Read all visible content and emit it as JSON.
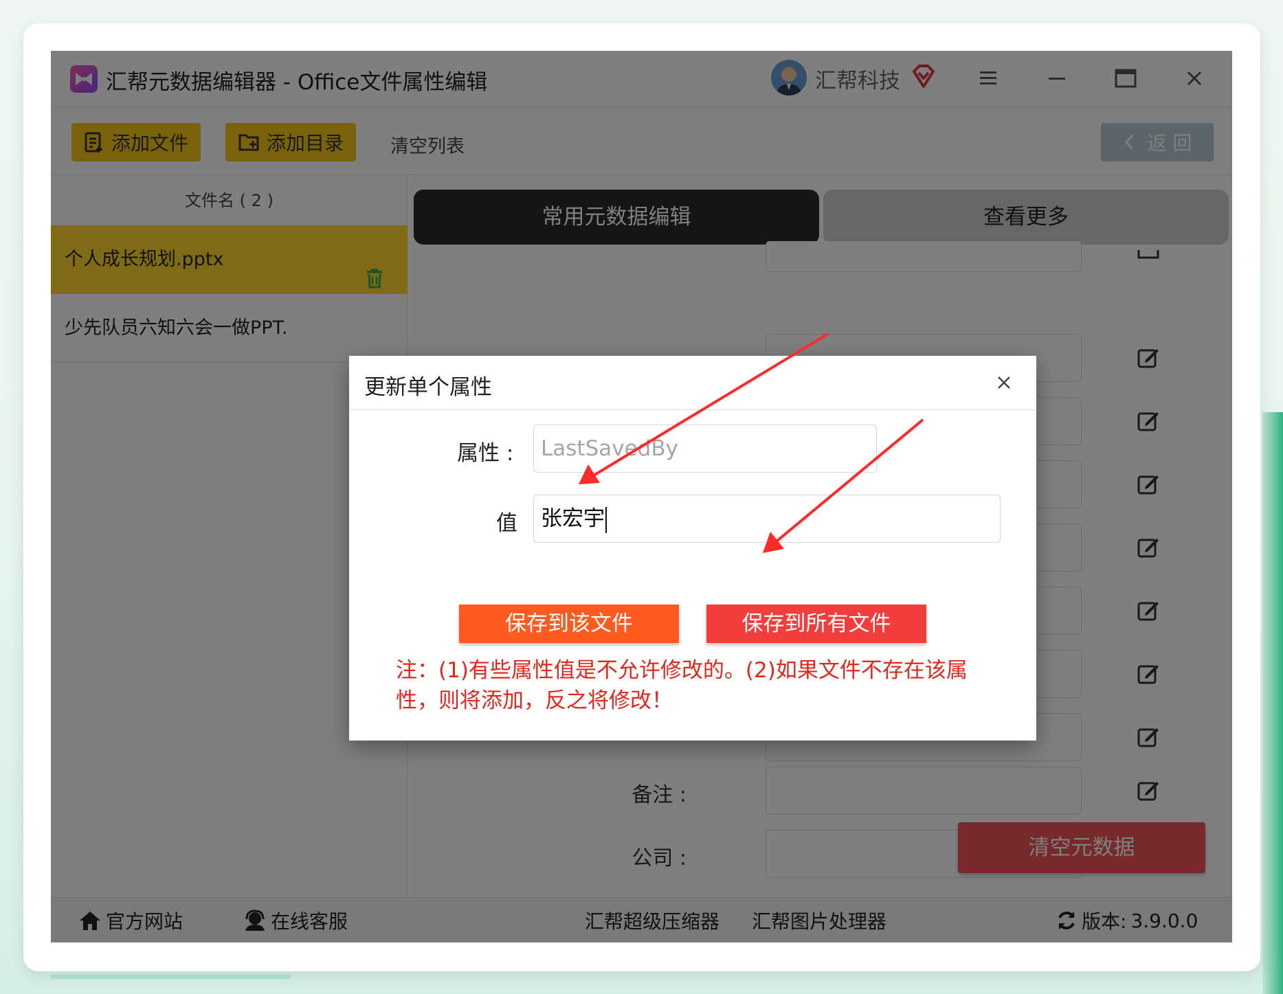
{
  "window": {
    "title": "汇帮元数据编辑器 - Office文件属性编辑",
    "user_name": "汇帮科技"
  },
  "icons": {
    "app_logo": "bowtie-logo-icon",
    "vip": "vip-diamond-icon",
    "menu": "hamburger-menu-icon",
    "minimize": "minimize-icon",
    "maximize": "maximize-icon",
    "close": "close-icon",
    "add_file": "add-file-icon",
    "add_folder": "add-folder-icon",
    "trash": "trash-icon",
    "edit": "edit-icon",
    "home": "home-icon",
    "support": "support-icon",
    "refresh": "refresh-icon"
  },
  "toolbar": {
    "add_file": "添加文件",
    "add_folder": "添加目录",
    "clear_list": "清空列表",
    "back": "返 回"
  },
  "files": {
    "header": "文件名 ( 2 )",
    "items": [
      {
        "name": "个人成长规划.pptx",
        "selected": true
      },
      {
        "name": "少先队员六知六会一做PPT.",
        "selected": false
      }
    ]
  },
  "tabs": {
    "active": "常用元数据编辑",
    "more": "查看更多"
  },
  "fields": [
    {
      "label": "备注 :"
    },
    {
      "label": "公司 :"
    }
  ],
  "clear_metadata": "清空元数据",
  "footer": {
    "website": "官方网站",
    "support": "在线客服",
    "compressor": "汇帮超级压缩器",
    "image_tool": "汇帮图片处理器",
    "version_label": "版本:",
    "version": "3.9.0.0"
  },
  "dialog": {
    "title": "更新单个属性",
    "property_label": "属性 :",
    "property_value": "LastSavedBy",
    "value_label": "值",
    "value_text": "张宏宇",
    "save_this": "保存到该文件",
    "save_all": "保存到所有文件",
    "note_line1": "注：(1)有些属性值是不允许修改的。(2)如果文件不存在该属",
    "note_line2": "性，则将添加，反之将修改！"
  },
  "colors": {
    "accent_yellow": "#f5c518",
    "save_this": "#ff5a1f",
    "save_all": "#f23d3d",
    "note_red": "#e3261e",
    "clear_meta": "#f05454",
    "annotation_arrow": "#ff2a2a"
  }
}
